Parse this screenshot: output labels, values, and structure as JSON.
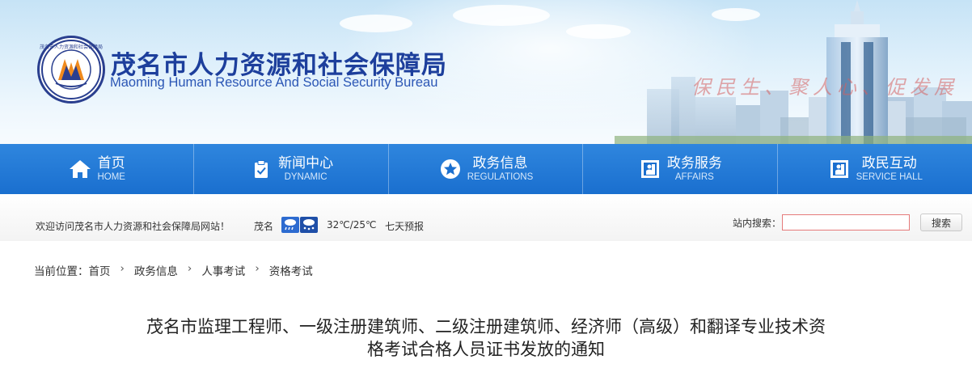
{
  "header": {
    "logo_text": "茂名市人力资源和社会保障局",
    "title_cn": "茂名市人力资源和社会保障局",
    "title_en": "Maoming Human Resource And Social Security Bureau",
    "slogan": "保民生、聚人心、促发展"
  },
  "nav": {
    "items": [
      {
        "label": "首页",
        "sub": "HOME",
        "icon": "home-icon"
      },
      {
        "label": "新闻中心",
        "sub": "DYNAMIC",
        "icon": "clipboard-check-icon"
      },
      {
        "label": "政务信息",
        "sub": "REGULATIONS",
        "icon": "star-circle-icon"
      },
      {
        "label": "政务服务",
        "sub": "AFFAIRS",
        "icon": "service-window-icon"
      },
      {
        "label": "政民互动",
        "sub": "SERVICE HALL",
        "icon": "service-window-icon"
      }
    ]
  },
  "infobar": {
    "welcome": "欢迎访问茂名市人力资源和社会保障局网站！",
    "city": "茂名",
    "weather_icons": [
      "rain-icon",
      "snow-rain-icon"
    ],
    "temperature": "32℃/25℃",
    "forecast_link": "七天预报",
    "search_label": "站内搜索：",
    "search_value": "",
    "search_button": "搜索"
  },
  "breadcrumb": {
    "prefix": "当前位置：",
    "items": [
      "首页",
      "政务信息",
      "人事考试",
      "资格考试"
    ],
    "separator": "›"
  },
  "article": {
    "title_line1": "茂名市监理工程师、一级注册建筑师、二级注册建筑师、经济师（高级）和翻译专业技术资",
    "title_line2": "格考试合格人员证书发放的通知"
  },
  "colors": {
    "nav_bg": "#1a6fcf",
    "title_blue": "#1d3f9c",
    "search_border": "#e57a7a"
  }
}
